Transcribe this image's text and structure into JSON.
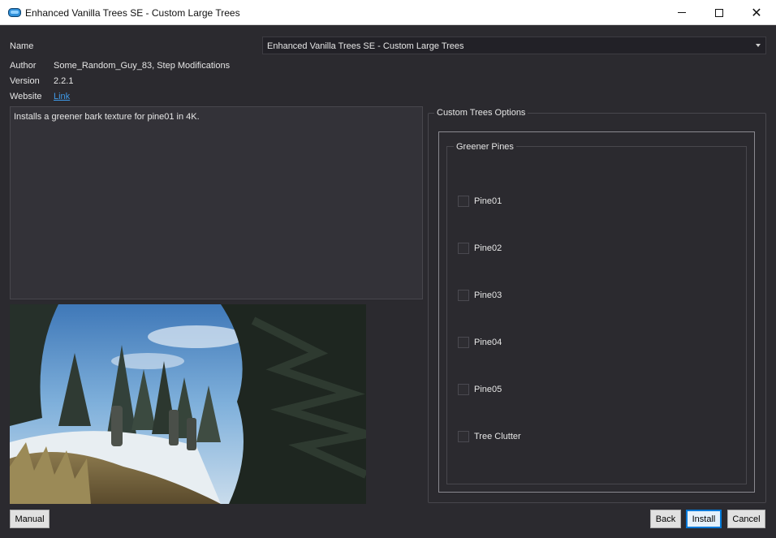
{
  "window": {
    "title": "Enhanced Vanilla Trees SE - Custom Large Trees",
    "minimize_glyph": "—",
    "close_glyph": "✕"
  },
  "info": {
    "name_label": "Name",
    "name_value": "Enhanced Vanilla Trees SE - Custom Large Trees",
    "author_label": "Author",
    "author_value": "Some_Random_Guy_83, Step Modifications",
    "version_label": "Version",
    "version_value": "2.2.1",
    "website_label": "Website",
    "website_value": "Link"
  },
  "description": "Installs a greener bark texture for pine01 in 4K.",
  "options": {
    "group_title": "Custom Trees Options",
    "subgroup_title": "Greener Pines",
    "items": [
      {
        "label": "Pine01",
        "checked": false
      },
      {
        "label": "Pine02",
        "checked": false
      },
      {
        "label": "Pine03",
        "checked": false
      },
      {
        "label": "Pine04",
        "checked": false
      },
      {
        "label": "Pine05",
        "checked": false
      },
      {
        "label": "Tree Clutter",
        "checked": false
      }
    ]
  },
  "buttons": {
    "manual": "Manual",
    "back": "Back",
    "install": "Install",
    "cancel": "Cancel"
  },
  "colors": {
    "background": "#2b2a2f",
    "accent": "#0078d7",
    "link": "#3f9ae8"
  }
}
